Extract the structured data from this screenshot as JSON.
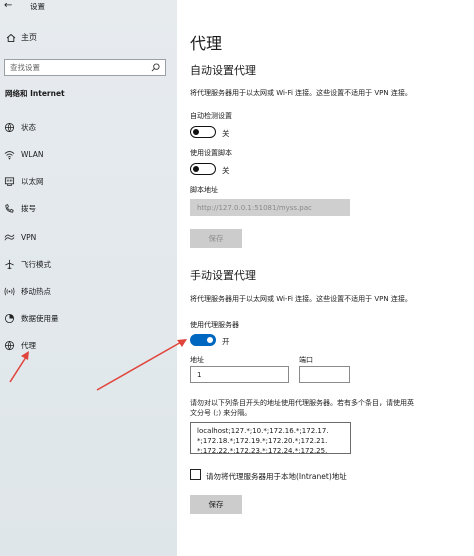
{
  "window": {
    "title": "设置",
    "back_glyph": "←"
  },
  "sidebar": {
    "home_label": "主页",
    "search_placeholder": "查找设置",
    "section_title": "网络和 Internet",
    "items": [
      {
        "label": "状态",
        "icon": "globe-status-icon"
      },
      {
        "label": "WLAN",
        "icon": "wifi-icon"
      },
      {
        "label": "以太网",
        "icon": "ethernet-icon"
      },
      {
        "label": "拨号",
        "icon": "phone-icon"
      },
      {
        "label": "VPN",
        "icon": "vpn-icon"
      },
      {
        "label": "飞行模式",
        "icon": "airplane-icon"
      },
      {
        "label": "移动热点",
        "icon": "hotspot-icon"
      },
      {
        "label": "数据使用量",
        "icon": "data-usage-icon"
      },
      {
        "label": "代理",
        "icon": "globe-icon",
        "selected": true
      }
    ]
  },
  "main": {
    "title": "代理",
    "auto": {
      "heading": "自动设置代理",
      "description": "将代理服务器用于以太网或 Wi-Fi 连接。这些设置不适用于 VPN 连接。",
      "detect_label": "自动检测设置",
      "detect_state": "关",
      "script_label": "使用设置脚本",
      "script_state": "关",
      "address_label": "脚本地址",
      "address_value": "http://127.0.0.1:51081/myss.pac",
      "save_label": "保存"
    },
    "manual": {
      "heading": "手动设置代理",
      "description": "将代理服务器用于以太网或 Wi-Fi 连接。这些设置不适用于 VPN 连接。",
      "use_proxy_label": "使用代理服务器",
      "use_proxy_state": "开",
      "address_label": "地址",
      "address_value": "1",
      "port_label": "端口",
      "port_value": "",
      "exceptions_description_line1": "请勿对以下列条目开头的地址使用代理服务器。若有多个条目，请使用英",
      "exceptions_description_line2": "文分号 (;) 来分隔。",
      "exceptions_line1": "localhost;127.*;10.*;172.16.*;172.17.",
      "exceptions_line2": "*;172.18.*;172.19.*;172.20.*;172.21.",
      "exceptions_line3": "*;172.22.*;172.23.*;172.24.*;172.25.",
      "intranet_label": "请勿将代理服务器用于本地(Intranet)地址",
      "save_label": "保存"
    }
  },
  "colors": {
    "accent": "#0067c0",
    "arrow": "#e0433a",
    "sidebar_bg": "#e3e9ed"
  }
}
